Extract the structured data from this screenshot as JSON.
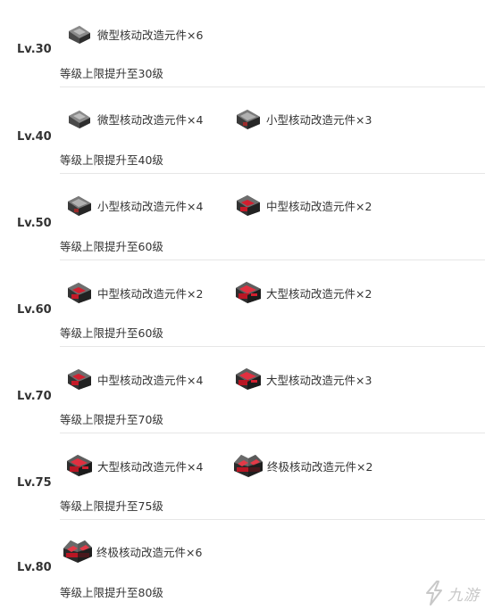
{
  "rows": [
    {
      "level": "Lv.30",
      "items": [
        {
          "icon": "micro-module-icon",
          "label": "微型核动改造元件×6"
        }
      ],
      "description": "等级上限提升至30级"
    },
    {
      "level": "Lv.40",
      "items": [
        {
          "icon": "micro-module-icon",
          "label": "微型核动改造元件×4"
        },
        {
          "icon": "small-module-icon",
          "label": "小型核动改造元件×3"
        }
      ],
      "description": "等级上限提升至40级"
    },
    {
      "level": "Lv.50",
      "items": [
        {
          "icon": "small-module-icon",
          "label": "小型核动改造元件×4"
        },
        {
          "icon": "medium-module-icon",
          "label": "中型核动改造元件×2"
        }
      ],
      "description": "等级上限提升至60级"
    },
    {
      "level": "Lv.60",
      "items": [
        {
          "icon": "medium-module-icon",
          "label": "中型核动改造元件×2"
        },
        {
          "icon": "large-module-icon",
          "label": "大型核动改造元件×2"
        }
      ],
      "description": "等级上限提升至60级"
    },
    {
      "level": "Lv.70",
      "items": [
        {
          "icon": "medium-module-icon",
          "label": "中型核动改造元件×4"
        },
        {
          "icon": "large-module-icon",
          "label": "大型核动改造元件×3"
        }
      ],
      "description": "等级上限提升至70级"
    },
    {
      "level": "Lv.75",
      "items": [
        {
          "icon": "large-module-icon",
          "label": "大型核动改造元件×4"
        },
        {
          "icon": "ultimate-module-icon",
          "label": "终极核动改造元件×2"
        }
      ],
      "description": "等级上限提升至75级"
    },
    {
      "level": "Lv.80",
      "items": [
        {
          "icon": "ultimate-module-icon",
          "label": "终极核动改造元件×6"
        }
      ],
      "description": "等级上限提升至80级"
    }
  ],
  "watermark": {
    "text": "九游",
    "icon": "jiuyou-logo-icon"
  },
  "colors": {
    "text": "#333333",
    "divider": "#e6e6e6",
    "module_dark": "#3a3a3a",
    "module_red": "#d21f2f"
  }
}
